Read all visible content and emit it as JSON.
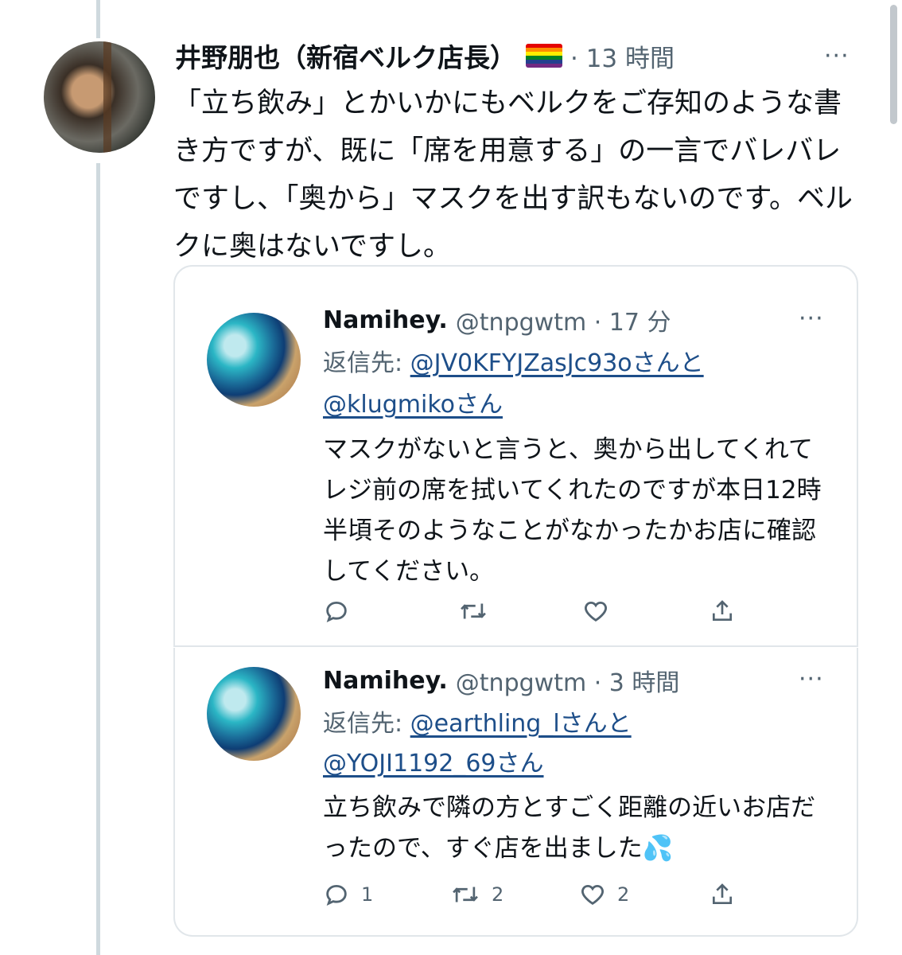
{
  "main_tweet": {
    "display_name": "井野朋也（新宿ベルク店長）",
    "time": "· 13 時間",
    "more": "···",
    "text": "「立ち飲み」とかいかにもベルクをご存知のような書き方ですが、既に「席を用意する」の一言でバレバレですし、「奥から」マスクを出す訳もないのです。ベルクに奥はないですし。",
    "flag_colors": [
      "#e40303",
      "#ff8c00",
      "#ffed00",
      "#008026",
      "#24408e",
      "#732982"
    ]
  },
  "quote_1": {
    "name": "Namihey.",
    "handle_time": "@tnpgwtm · 17 分",
    "more": "···",
    "reply_prefix": "返信先: ",
    "mention_1": "@JV0KFYJZasJc93oさんと",
    "mention_2": "@klugmikoさん",
    "text": "マスクがないと言うと、奥から出してくれてレジ前の席を拭いてくれたのですが本日12時半頃そのようなことがなかったかお店に確認してください。",
    "counts": {
      "reply": "",
      "retweet": "",
      "like": ""
    }
  },
  "quote_2": {
    "name": "Namihey.",
    "handle_time": "@tnpgwtm · 3 時間",
    "more": "···",
    "reply_prefix": "返信先: ",
    "mention_1": "@earthling_lさんと",
    "mention_2": "@YOJI1192_69さん",
    "text": "立ち飲みで隣の方とすごく距離の近いお店だったので、すぐ店を出ました💦",
    "counts": {
      "reply": "1",
      "retweet": "2",
      "like": "2"
    }
  }
}
